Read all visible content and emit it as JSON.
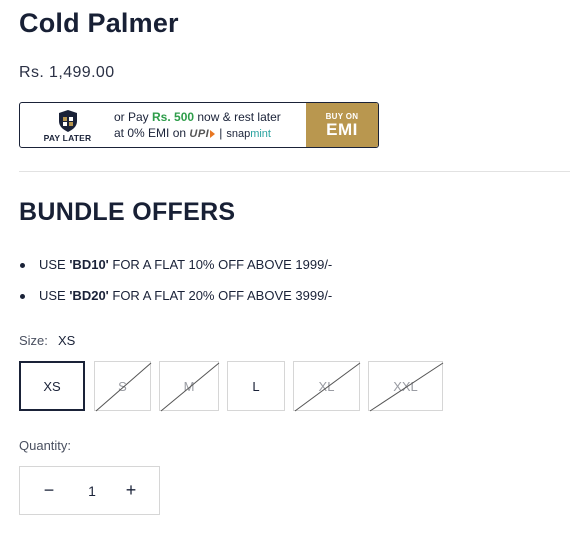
{
  "product": {
    "title": "Cold Palmer",
    "price": "Rs. 1,499.00"
  },
  "emi_banner": {
    "pay_later": "PAY LATER",
    "line1_pre": "or Pay ",
    "line1_amount": "Rs. 500",
    "line1_post": " now & rest later",
    "line2_pre": "at 0% EMI on ",
    "upi": "UPI",
    "snap": "snap",
    "mint": "mint",
    "buy_on": "BUY ON",
    "emi": "EMI",
    "colors": {
      "accent": "#b9974f",
      "amount": "#2e9d4a"
    }
  },
  "bundle": {
    "title": "BUNDLE OFFERS",
    "offers": [
      {
        "pre": "USE ",
        "code": "'BD10'",
        "post": " FOR A FLAT 10% OFF ABOVE 1999/-"
      },
      {
        "pre": "USE ",
        "code": "'BD20'",
        "post": " FOR A FLAT 20% OFF ABOVE 3999/-"
      }
    ]
  },
  "size": {
    "label": "Size:",
    "selected": "XS",
    "options": [
      {
        "label": "XS",
        "available": true,
        "selected": true
      },
      {
        "label": "S",
        "available": false,
        "selected": false
      },
      {
        "label": "M",
        "available": false,
        "selected": false
      },
      {
        "label": "L",
        "available": true,
        "selected": false
      },
      {
        "label": "XL",
        "available": false,
        "selected": false
      },
      {
        "label": "XXL",
        "available": false,
        "selected": false
      }
    ]
  },
  "quantity": {
    "label": "Quantity:",
    "value": "1",
    "minus": "−",
    "plus": "+"
  }
}
